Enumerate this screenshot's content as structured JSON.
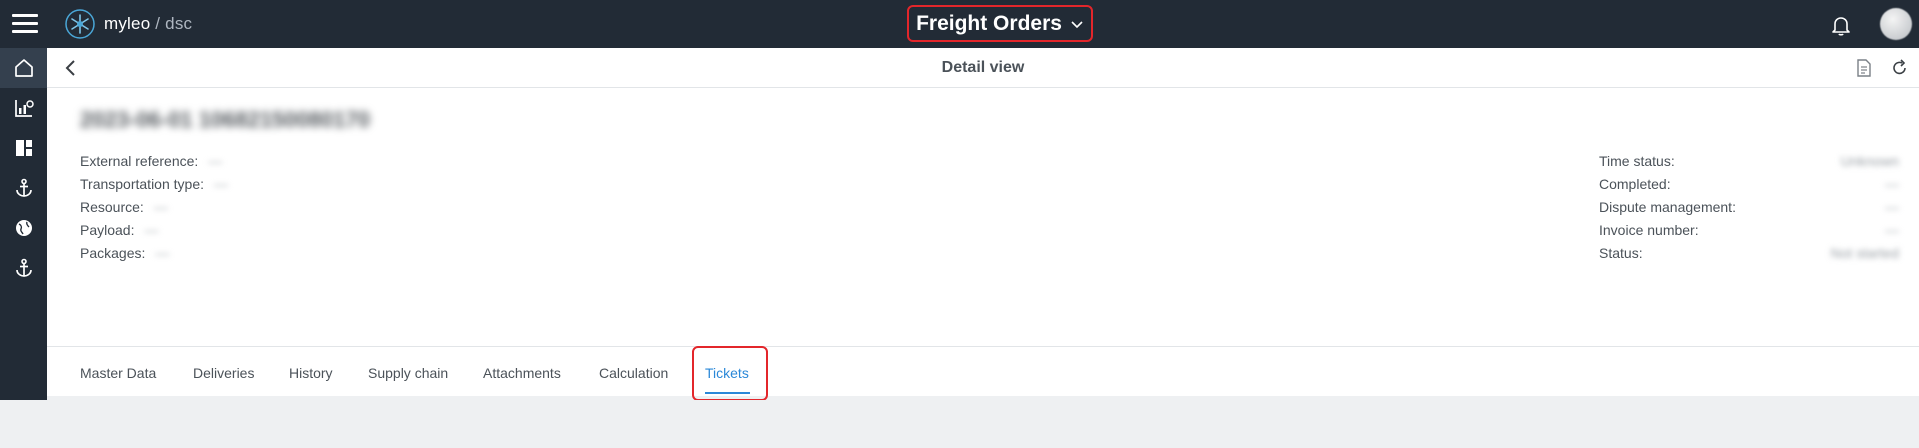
{
  "app": {
    "logo_name": "myleo",
    "logo_separator": "/",
    "logo_product": "dsc",
    "module_title": "Freight Orders",
    "accent_color": "#2b88d8",
    "highlight_color": "#e3262b",
    "topbar_color": "#222b36"
  },
  "header": {
    "title": "Detail view"
  },
  "record": {
    "title": "2023-06-01 10682150080170",
    "fields_left": [
      {
        "label": "External reference:",
        "value": "—"
      },
      {
        "label": "Transportation type:",
        "value": "—"
      },
      {
        "label": "Resource:",
        "value": "—"
      },
      {
        "label": "Payload:",
        "value": "—"
      },
      {
        "label": "Packages:",
        "value": "—"
      }
    ],
    "fields_right": [
      {
        "label": "Time status:",
        "value": "Unknown"
      },
      {
        "label": "Completed:",
        "value": "—"
      },
      {
        "label": "Dispute management:",
        "value": "—"
      },
      {
        "label": "Invoice number:",
        "value": "—"
      },
      {
        "label": "Status:",
        "value": "Not started"
      }
    ]
  },
  "tabs": [
    {
      "label": "Master Data"
    },
    {
      "label": "Deliveries"
    },
    {
      "label": "History"
    },
    {
      "label": "Supply chain"
    },
    {
      "label": "Attachments"
    },
    {
      "label": "Calculation"
    },
    {
      "label": "Tickets",
      "active": true
    }
  ],
  "sidenav": [
    "home-icon",
    "analytics-icon",
    "dashboard-icon",
    "anchor-icon",
    "globe-icon",
    "anchor-icon"
  ]
}
